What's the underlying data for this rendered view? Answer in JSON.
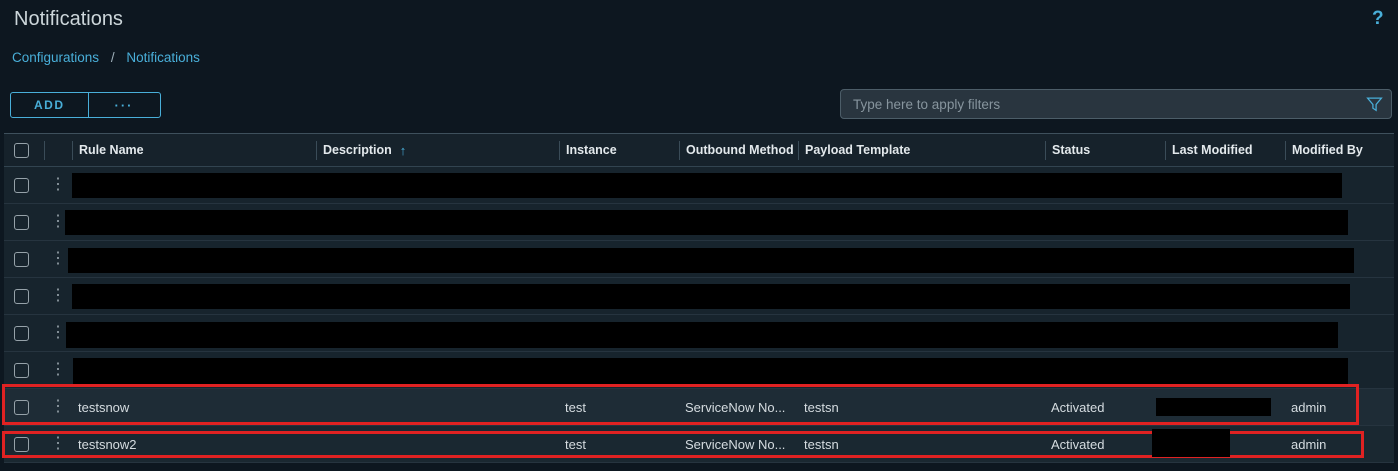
{
  "page": {
    "title": "Notifications"
  },
  "icons": {
    "kebab": "⋮",
    "sort_up": "↑",
    "help": "?"
  },
  "breadcrumb": {
    "items": [
      "Configurations",
      "Notifications"
    ],
    "separator": "/"
  },
  "toolbar": {
    "add_label": "ADD",
    "more_label": "···",
    "filter": {
      "placeholder": "Type here to apply filters",
      "value": ""
    }
  },
  "table": {
    "columns": [
      "Rule Name",
      "Description",
      "Instance",
      "Outbound Method",
      "Payload Template",
      "Status",
      "Last Modified",
      "Modified By"
    ],
    "sort": {
      "column": "Description",
      "direction": "ascending"
    },
    "rows": [
      {
        "kind": "redacted",
        "bar_style": "left:68px;top:6px;width:1270px;height:25px"
      },
      {
        "kind": "redacted",
        "bar_style": "left:61px;top:6px;width:1283px;height:25px"
      },
      {
        "kind": "redacted",
        "bar_style": "left:64px;top:7px;width:1286px;height:25px"
      },
      {
        "kind": "redacted",
        "bar_style": "left:68px;top:6px;width:1278px;height:25px"
      },
      {
        "kind": "redacted",
        "bar_style": "left:62px;top:7px;width:1272px;height:26px"
      },
      {
        "kind": "redacted",
        "bar_style": "left:69px;top:6px;width:1275px;height:26px"
      },
      {
        "kind": "data",
        "rule_name": "testsnow",
        "description": "",
        "instance": "test",
        "outbound_method": "ServiceNow No...",
        "payload_template": "testsn",
        "status": "Activated",
        "last_modified_bar_style": "left:1152px;top:9px;width:115px;height:18px",
        "modified_by": "admin"
      },
      {
        "kind": "data",
        "rule_name": "testsnow2",
        "description": "",
        "instance": "test",
        "outbound_method": "ServiceNow No...",
        "payload_template": "testsn",
        "status": "Activated",
        "last_modified_bar_style": "left:1148px;top:3px;width:78px;height:28px;z-index:12",
        "modified_by": "admin"
      }
    ]
  },
  "annotations": {
    "color": "#e02222",
    "boxes": [
      {
        "target": "row-testsnow",
        "style": "left:2px;top:384px;width:1357px;height:41px"
      },
      {
        "target": "row-testsnow2",
        "style": "left:2px;top:431px;width:1362px;height:27px"
      }
    ]
  },
  "colors": {
    "accent_blue": "#49afd9",
    "page_background": "#0d1720",
    "row_background": "#17242d",
    "redaction_black": "#000000",
    "annotation_red": "#e02222"
  }
}
